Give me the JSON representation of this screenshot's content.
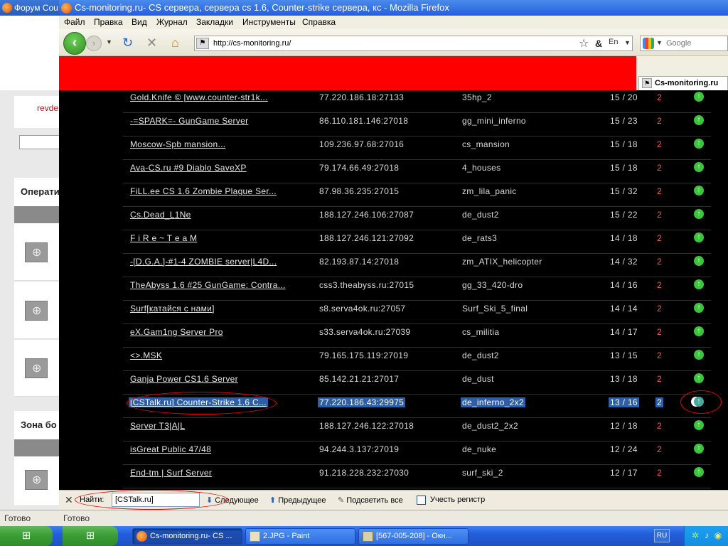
{
  "background_window": {
    "title": "Форум Cou",
    "link_text": "revde",
    "heading1": "Операти",
    "heading2": "Зона бо",
    "status": "Готово"
  },
  "browser": {
    "title": "Cs-monitoring.ru- CS сервера, сервера cs 1.6, Counter-strike сервера, кс - Mozilla Firefox",
    "menu": [
      "Файл",
      "Правка",
      "Вид",
      "Журнал",
      "Закладки",
      "Инструменты",
      "Справка"
    ],
    "url": "http://cs-monitoring.ru/",
    "search_placeholder": "Google",
    "tab_label": "Cs-monitoring.ru",
    "status": "Готово"
  },
  "servers": [
    {
      "name": "Gold.Knife © [www.counter-str1k...",
      "ip": "77.220.186.18:27133",
      "map": "35hp_2",
      "players": "15 / 20",
      "stat": "2"
    },
    {
      "name": "-=SPARK=- GunGame Server",
      "ip": "86.110.181.146:27018",
      "map": "gg_mini_inferno",
      "players": "15 / 23",
      "stat": "2"
    },
    {
      "name": "Moscow-Spb mansion...",
      "ip": "109.236.97.68:27016",
      "map": "cs_mansion",
      "players": "15 / 18",
      "stat": "2"
    },
    {
      "name": "Ava-CS.ru #9 Diablo SaveXP",
      "ip": "79.174.66.49:27018",
      "map": "4_houses",
      "players": "15 / 18",
      "stat": "2"
    },
    {
      "name": "FiLL.ee CS 1.6 Zombie Plague Ser...",
      "ip": "87.98.36.235:27015",
      "map": "zm_lila_panic",
      "players": "15 / 32",
      "stat": "2"
    },
    {
      "name": "Cs.Dead_L1Ne",
      "ip": "188.127.246.106:27087",
      "map": "de_dust2",
      "players": "15 / 22",
      "stat": "2"
    },
    {
      "name": "F i R e ~ T e a M",
      "ip": "188.127.246.121:27092",
      "map": "de_rats3",
      "players": "14 / 18",
      "stat": "2"
    },
    {
      "name": "-[D.G.A.]-#1-4 ZOMBIE server|L4D...",
      "ip": "82.193.87.14:27018",
      "map": "zm_ATIX_helicopter",
      "players": "14 / 32",
      "stat": "2"
    },
    {
      "name": "TheAbyss 1.6 #25 GunGame: Contra...",
      "ip": "css3.theabyss.ru:27015",
      "map": "gg_33_420-dro",
      "players": "14 / 16",
      "stat": "2"
    },
    {
      "name": "Surf[катайся с нами]",
      "ip": "s8.serva4ok.ru:27057",
      "map": "Surf_Ski_5_final",
      "players": "14 / 14",
      "stat": "2"
    },
    {
      "name": "eX.Gam1ng Server Pro",
      "ip": "s33.serva4ok.ru:27039",
      "map": "cs_militia",
      "players": "14 / 17",
      "stat": "2"
    },
    {
      "name": "<>.MSK",
      "ip": "79.165.175.119:27019",
      "map": "de_dust2",
      "players": "13 / 15",
      "stat": "2"
    },
    {
      "name": "Ganja Power CS1.6 Server",
      "ip": "85.142.21.21:27017",
      "map": "de_dust",
      "players": "13 / 18",
      "stat": "2"
    },
    {
      "name": "[CSTalk.ru] Counter-Strike 1.6 C...",
      "ip": "77.220.186.43:29975",
      "map": "de_inferno_2x2",
      "players": "13 / 16",
      "stat": "2",
      "highlighted": true
    },
    {
      "name": "Server T3|A|L",
      "ip": "188.127.246.122:27018",
      "map": "de_dust2_2x2",
      "players": "12 / 18",
      "stat": "2"
    },
    {
      "name": "isGreat Public 47/48",
      "ip": "94.244.3.137:27019",
      "map": "de_nuke",
      "players": "12 / 24",
      "stat": "2"
    },
    {
      "name": "End-tm | Surf Server",
      "ip": "91.218.228.232:27030",
      "map": "surf_ski_2",
      "players": "12 / 17",
      "stat": "2"
    }
  ],
  "findbar": {
    "label": "Найти:",
    "value": "[CSTalk.ru]",
    "next": "Следующее",
    "prev": "Предыдущее",
    "highlight_all": "Подсветить все",
    "match_case": "Учесть регистр"
  },
  "taskbar": {
    "tasks": [
      "Cs-monitoring.ru- CS ...",
      "2.JPG - Paint",
      "[567-005-208] - Окн..."
    ],
    "language": "RU"
  },
  "colors": {
    "red_block": "#ff0000",
    "content_bg": "#000000",
    "stat": "#ff5a5a",
    "arrow": "#3cc43c",
    "selection": "#2e5ea8"
  }
}
